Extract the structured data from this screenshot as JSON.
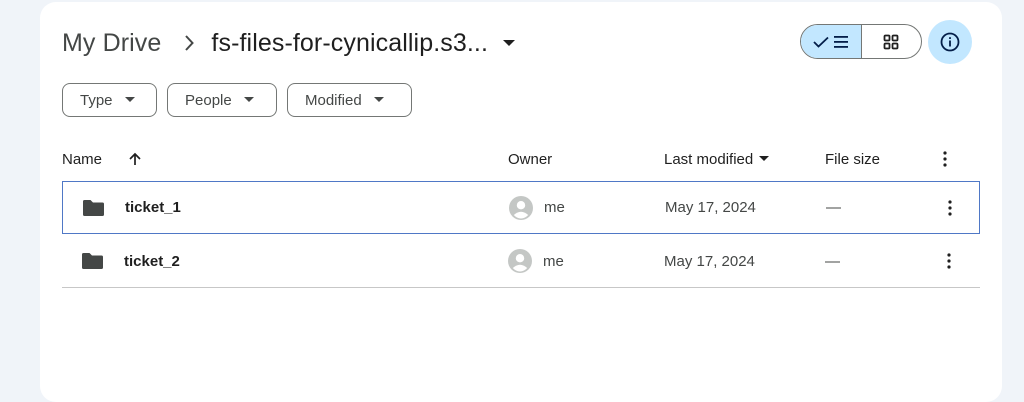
{
  "breadcrumb": {
    "root": "My Drive",
    "current": "fs-files-for-cynicallip.s3..."
  },
  "filters": [
    {
      "label": "Type"
    },
    {
      "label": "People"
    },
    {
      "label": "Modified"
    }
  ],
  "table": {
    "columns": {
      "name": "Name",
      "owner": "Owner",
      "last_modified": "Last modified",
      "file_size": "File size"
    },
    "rows": [
      {
        "name": "ticket_1",
        "owner": "me",
        "last_modified": "May 17, 2024",
        "file_size": "—",
        "selected": true
      },
      {
        "name": "ticket_2",
        "owner": "me",
        "last_modified": "May 17, 2024",
        "file_size": "—",
        "selected": false
      }
    ]
  },
  "colors": {
    "accent": "#c2e7ff",
    "selection_border": "#4f78c6",
    "folder": "#444746"
  },
  "icons": {
    "sep": "chevron-right-icon",
    "folder": "folder-icon",
    "avatar": "account-circle-icon",
    "more": "more-vert-icon",
    "info": "info-icon",
    "list_view": "list-view-icon",
    "grid_view": "grid-view-icon"
  }
}
